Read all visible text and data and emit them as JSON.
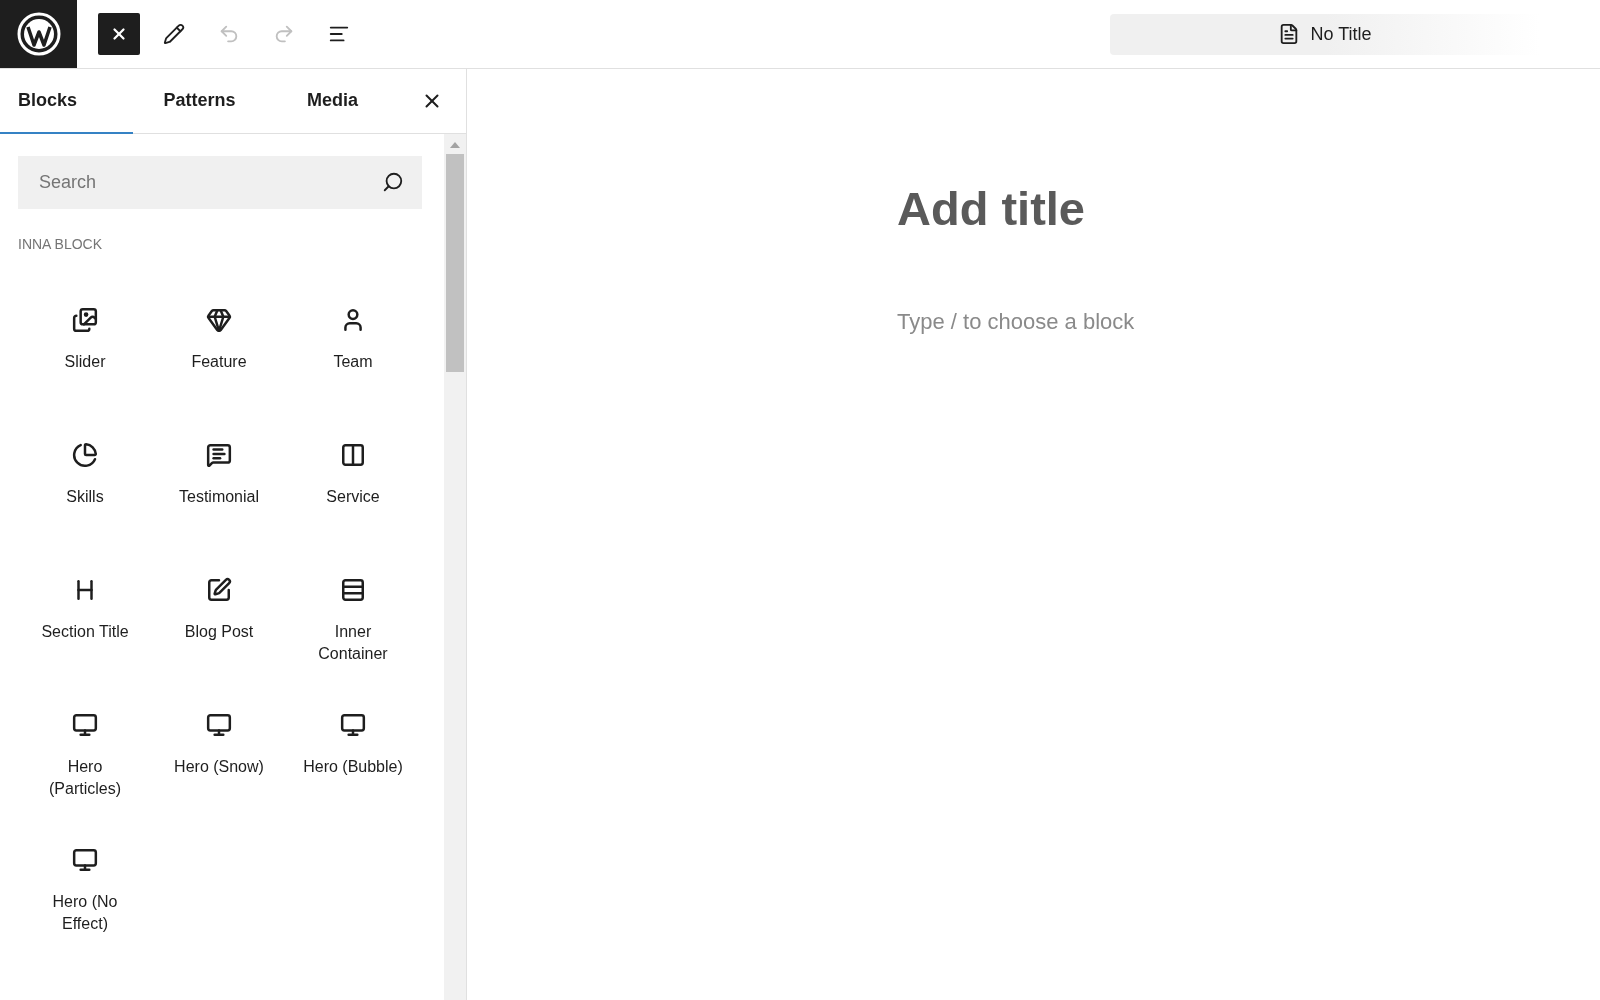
{
  "toolbar": {
    "buttons": [
      {
        "kind": "close",
        "active": true,
        "disabled": false
      },
      {
        "kind": "edit",
        "active": false,
        "disabled": false
      },
      {
        "kind": "undo",
        "active": false,
        "disabled": true
      },
      {
        "kind": "redo",
        "active": false,
        "disabled": true
      },
      {
        "kind": "list",
        "active": false,
        "disabled": false
      }
    ],
    "document_title": "No Title"
  },
  "inserter": {
    "tabs": [
      {
        "label": "Blocks",
        "selected": true
      },
      {
        "label": "Patterns",
        "selected": false
      },
      {
        "label": "Media",
        "selected": false
      }
    ],
    "search": {
      "placeholder": "Search"
    },
    "category": "INNA BLOCK",
    "blocks": [
      {
        "label": "Slider"
      },
      {
        "label": "Feature"
      },
      {
        "label": "Team"
      },
      {
        "label": "Skills"
      },
      {
        "label": "Testimonial"
      },
      {
        "label": "Service"
      },
      {
        "label": "Section Title"
      },
      {
        "label": "Blog Post"
      },
      {
        "label": "Inner Container"
      },
      {
        "label": "Hero (Particles)"
      },
      {
        "label": "Hero (Snow)"
      },
      {
        "label": "Hero (Bubble)"
      },
      {
        "label": "Hero (No Effect)"
      }
    ]
  },
  "editor": {
    "title_placeholder": "Add title",
    "block_placeholder": "Type / to choose a block"
  }
}
